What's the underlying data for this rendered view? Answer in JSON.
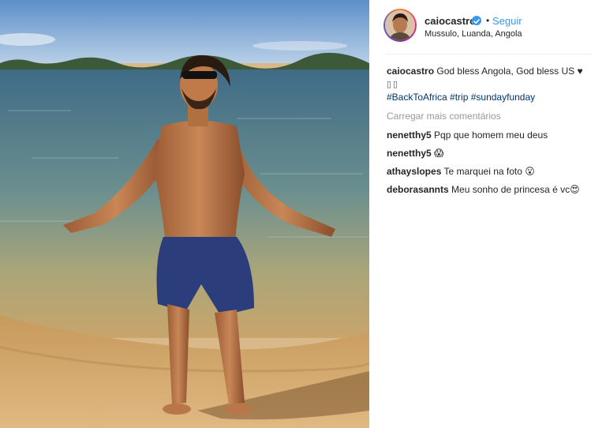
{
  "post": {
    "username": "caiocastro",
    "follow_label": "Seguir",
    "dot": "•",
    "location": "Mussulo, Luanda, Angola",
    "caption": {
      "username": "caiocastro",
      "text": "God bless Angola, God bless US ♥",
      "text_line2": "▯▯",
      "hashtags": [
        "#BackToAfrica",
        "#trip",
        "#sundayfunday"
      ]
    },
    "load_more_label": "Carregar mais comentários",
    "comments": [
      {
        "user": "nenetthy5",
        "text": "Pqp que homem meu deus"
      },
      {
        "user": "nenetthy5",
        "text": "😱"
      },
      {
        "user": "athayslopes",
        "text": "Te marquei na foto 😮"
      },
      {
        "user": "deborasannts",
        "text": "Meu sonho de princesa é vc😍"
      }
    ]
  },
  "icons": {
    "verified": "verified-badge-icon",
    "avatar": "profile-avatar"
  },
  "colors": {
    "link": "#3897f0",
    "hashtag": "#003569",
    "muted": "#999999"
  }
}
